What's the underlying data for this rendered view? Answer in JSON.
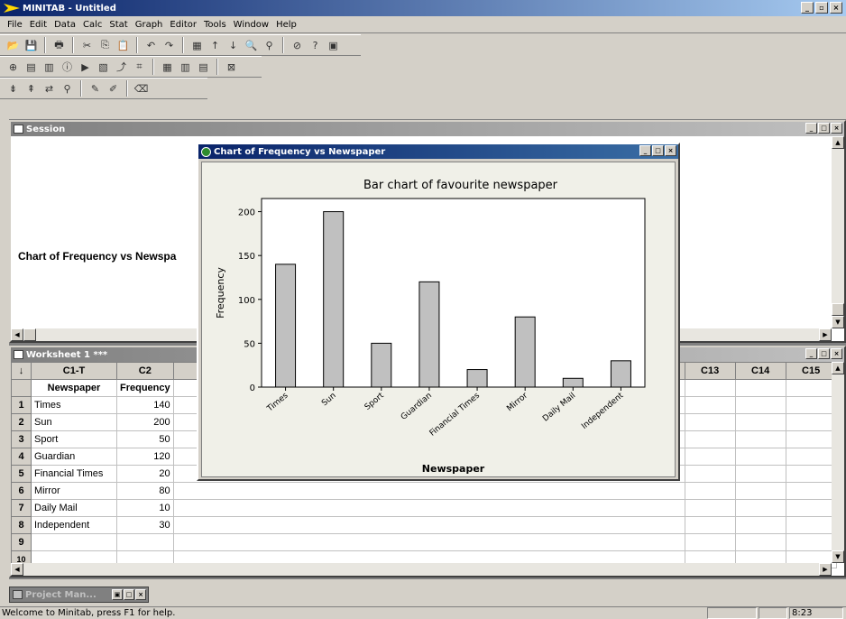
{
  "app": {
    "title": "MINITAB - Untitled"
  },
  "menu": [
    "File",
    "Edit",
    "Data",
    "Calc",
    "Stat",
    "Graph",
    "Editor",
    "Tools",
    "Window",
    "Help"
  ],
  "session": {
    "title": "Session",
    "text": "Chart of Frequency vs Newspa"
  },
  "worksheet": {
    "title": "Worksheet 1 ***",
    "corner": "↓",
    "columns": [
      "C1-T",
      "C2",
      "C13",
      "C14",
      "C15"
    ],
    "column_names": [
      "Newspaper",
      "Frequency"
    ],
    "rows": [
      {
        "n": "1",
        "newspaper": "Times",
        "frequency": "140"
      },
      {
        "n": "2",
        "newspaper": "Sun",
        "frequency": "200"
      },
      {
        "n": "3",
        "newspaper": "Sport",
        "frequency": "50"
      },
      {
        "n": "4",
        "newspaper": "Guardian",
        "frequency": "120"
      },
      {
        "n": "5",
        "newspaper": "Financial Times",
        "frequency": "20"
      },
      {
        "n": "6",
        "newspaper": "Mirror",
        "frequency": "80"
      },
      {
        "n": "7",
        "newspaper": "Daily Mail",
        "frequency": "10"
      },
      {
        "n": "8",
        "newspaper": "Independent",
        "frequency": "30"
      },
      {
        "n": "9",
        "newspaper": "",
        "frequency": ""
      },
      {
        "n": "10",
        "newspaper": "",
        "frequency": ""
      }
    ]
  },
  "chart_window": {
    "title": "Chart of Frequency vs Newspaper"
  },
  "chart_data": {
    "type": "bar",
    "title": "Bar chart of favourite newspaper",
    "xlabel": "Newspaper",
    "ylabel": "Frequency",
    "categories": [
      "Times",
      "Sun",
      "Sport",
      "Guardian",
      "Financial Times",
      "Mirror",
      "Daily Mail",
      "Independent"
    ],
    "values": [
      140,
      200,
      50,
      120,
      20,
      80,
      10,
      30
    ],
    "ylim": [
      0,
      215
    ],
    "yticks": [
      0,
      50,
      100,
      150,
      200
    ],
    "bar_color": "#c0c0c0",
    "grid": false
  },
  "project_manager": {
    "title": "Project Man..."
  },
  "status": {
    "message": "Welcome to Minitab, press F1 for help.",
    "time": "8:23"
  },
  "colors": {
    "title_active": "#0a246a",
    "title_inactive": "#808080",
    "chrome": "#d4d0c8"
  }
}
